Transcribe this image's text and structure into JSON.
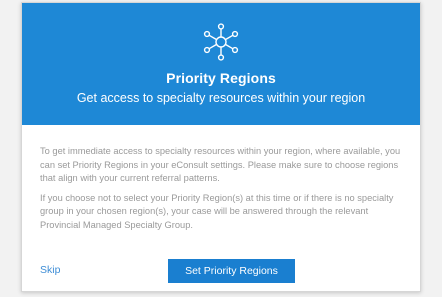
{
  "dialog": {
    "icon": "network-hub-icon",
    "title": "Priority Regions",
    "subtitle": "Get access to specialty resources within your region",
    "paragraph1": "To get immediate access to specialty resources within your region, where available, you can set Priority Regions in your eConsult settings. Please make sure to choose regions that align with your current referral patterns.",
    "paragraph2": "If you choose not to select your Priority Region(s) at this time or if there is no specialty group in your chosen region(s), your case will be answered through the relevant Provincial Managed Specialty Group.",
    "skip_label": "Skip",
    "primary_label": "Set Priority Regions"
  },
  "colors": {
    "header_bg": "#1e88d6",
    "button_bg": "#1a7fd0",
    "link": "#3f8ed6",
    "body_text": "#9a9a9a"
  }
}
